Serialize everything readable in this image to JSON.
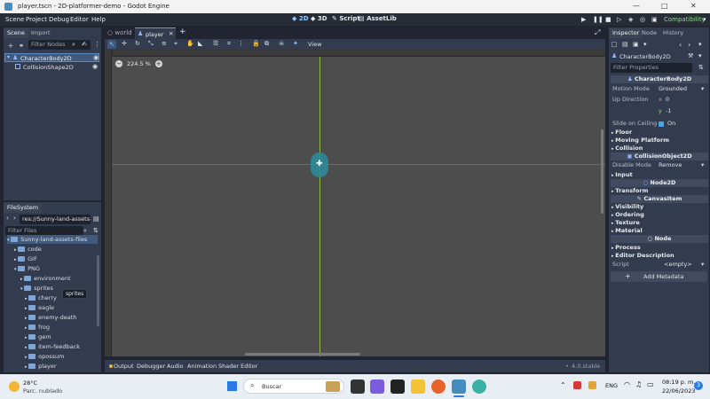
{
  "window": {
    "title": "player.tscn - 2D-platformer-demo - Godot Engine"
  },
  "menubar": {
    "menus": [
      "Scene",
      "Project",
      "Debug",
      "Editor",
      "Help"
    ],
    "workspaces": [
      "2D",
      "3D",
      "Script",
      "AssetLib"
    ],
    "renderer": "Compatibility"
  },
  "scene_dock": {
    "tabs": [
      "Scene",
      "Import"
    ],
    "filter_placeholder": "Filter Nodes",
    "nodes": [
      "CharacterBody2D",
      "CollisionShape2D"
    ]
  },
  "filesystem": {
    "tab": "FileSystem",
    "path": "res://Sunny-land-assets-file",
    "filter_placeholder": "Filter Files",
    "items": [
      {
        "label": "Sunny-land-assets-files"
      },
      {
        "label": "code"
      },
      {
        "label": "GIF"
      },
      {
        "label": "PNG"
      },
      {
        "label": "environment"
      },
      {
        "label": "sprites"
      },
      {
        "label": "cherry"
      },
      {
        "label": "eagle"
      },
      {
        "label": "enemy-death"
      },
      {
        "label": "frog"
      },
      {
        "label": "gem"
      },
      {
        "label": "item-feedback"
      },
      {
        "label": "opossum"
      },
      {
        "label": "player"
      }
    ],
    "tooltip": "sprites"
  },
  "editor_tabs": [
    "world",
    "player"
  ],
  "viewport": {
    "zoom": "224.5 %",
    "view_menu": "View"
  },
  "bottom_panel": {
    "tabs": [
      "Output",
      "Debugger",
      "Audio",
      "Animation",
      "Shader Editor"
    ],
    "version": "4.0.stable"
  },
  "inspector": {
    "tabs": [
      "Inspector",
      "Node",
      "History"
    ],
    "object": "CharacterBody2D",
    "filter_placeholder": "Filter Properties",
    "class_header": "CharacterBody2D",
    "motion_mode_label": "Motion Mode",
    "motion_mode_value": "Grounded",
    "up_direction_label": "Up Direction",
    "up_x_label": "x",
    "up_x": "0",
    "up_y_label": "y",
    "up_y": "-1",
    "slide_label": "Slide on Ceiling",
    "slide_value": "On",
    "floor": "Floor",
    "moving_platform": "Moving Platform",
    "collision": "Collision",
    "collision_object": "CollisionObject2D",
    "disable_mode_label": "Disable Mode",
    "disable_mode_value": "Remove",
    "input": "Input",
    "node2d": "Node2D",
    "transform": "Transform",
    "canvas_item": "CanvasItem",
    "visibility": "Visibility",
    "ordering": "Ordering",
    "texture": "Texture",
    "material": "Material",
    "node": "Node",
    "process": "Process",
    "editor_description": "Editor Description",
    "script_label": "Script",
    "script_value": "<empty>",
    "add_metadata": "Add Metadata"
  },
  "taskbar": {
    "temperature": "28°C",
    "weather": "Parc. nublado",
    "search": "Buscar",
    "language": "ENG",
    "time": "08:19 p. m.",
    "date": "22/06/2023",
    "notifications": "3"
  },
  "colors": {
    "accent": "#4ba3e8",
    "body": "#2e8b9a",
    "xaxis": "#b5475e",
    "yaxis": "#8fb34a"
  }
}
